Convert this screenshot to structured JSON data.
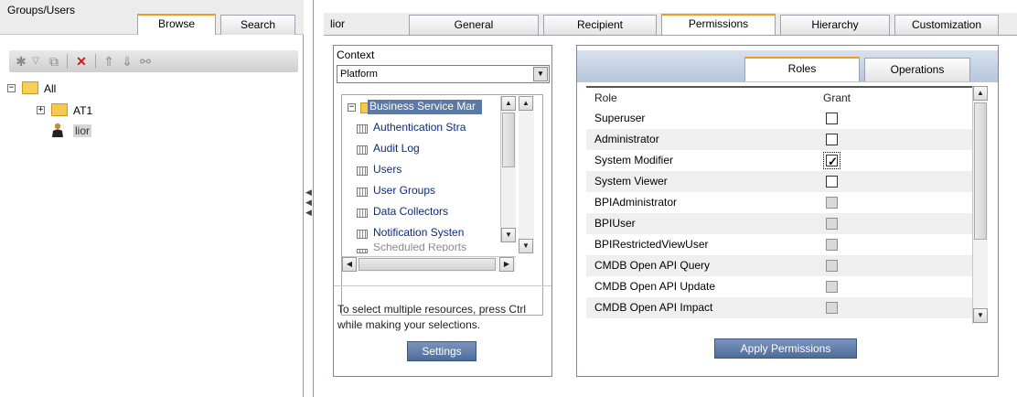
{
  "left": {
    "title": "Groups/Users",
    "tabs": [
      {
        "label": "Browse"
      },
      {
        "label": "Search"
      }
    ],
    "toolbar_icons": [
      "filter-icon",
      "dropdown-icon",
      "copy-icon",
      "delete-icon",
      "move-up-icon",
      "move-down-icon",
      "link-icon"
    ],
    "tree": {
      "root": "All",
      "group": "AT1",
      "user": "lior"
    }
  },
  "right": {
    "title": "lior",
    "tabs": [
      {
        "label": "General"
      },
      {
        "label": "Recipient"
      },
      {
        "label": "Permissions"
      },
      {
        "label": "Hierarchy"
      },
      {
        "label": "Customization"
      }
    ],
    "active_tab": "Permissions"
  },
  "context": {
    "label": "Context",
    "selected": "Platform",
    "root": "Business Service Mar",
    "resources": [
      "Authentication Stra",
      "Audit Log",
      "Users",
      "User Groups",
      "Data Collectors",
      "Notification Systen",
      "Scheduled Reports"
    ],
    "hint": "To select multiple resources, press Ctrl while making your selections.",
    "settings_label": "Settings"
  },
  "roles": {
    "tabs": [
      {
        "label": "Roles"
      },
      {
        "label": "Operations"
      }
    ],
    "header_role": "Role",
    "header_grant": "Grant",
    "rows": [
      {
        "name": "Superuser",
        "granted": false,
        "enabled": true
      },
      {
        "name": "Administrator",
        "granted": false,
        "enabled": true
      },
      {
        "name": "System Modifier",
        "granted": true,
        "enabled": true
      },
      {
        "name": "System Viewer",
        "granted": false,
        "enabled": true
      },
      {
        "name": "BPIAdministrator",
        "granted": false,
        "enabled": false
      },
      {
        "name": "BPIUser",
        "granted": false,
        "enabled": false
      },
      {
        "name": "BPIRestrictedViewUser",
        "granted": false,
        "enabled": false
      },
      {
        "name": "CMDB Open API Query",
        "granted": false,
        "enabled": false
      },
      {
        "name": "CMDB Open API Update",
        "granted": false,
        "enabled": false
      },
      {
        "name": "CMDB Open API Impact",
        "granted": false,
        "enabled": false
      }
    ],
    "apply_label": "Apply Permissions"
  },
  "colors": {
    "active_tab_accent": "#f39a1e",
    "selection_blue": "#5b79a3",
    "link_blue": "#0b2a7c"
  }
}
